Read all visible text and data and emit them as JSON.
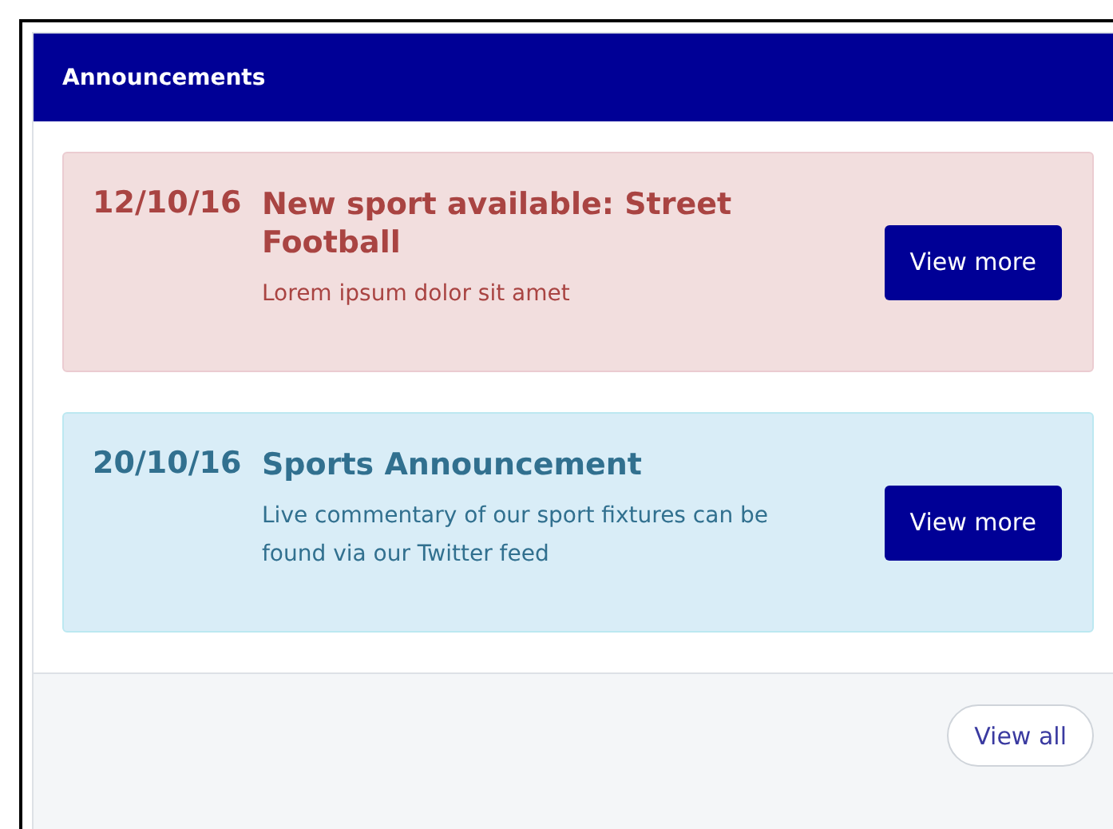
{
  "panel": {
    "title": "Announcements"
  },
  "announcements": [
    {
      "kind": "danger",
      "date": "12/10/16",
      "title": "New sport available: Street Football",
      "body": "Lorem ipsum dolor sit amet",
      "button": "View more"
    },
    {
      "kind": "info",
      "date": "20/10/16",
      "title": "Sports Announcement",
      "body": "Live commentary of our sport fixtures can be found via our Twitter feed",
      "button": "View more"
    }
  ],
  "footer": {
    "button": "View all"
  }
}
